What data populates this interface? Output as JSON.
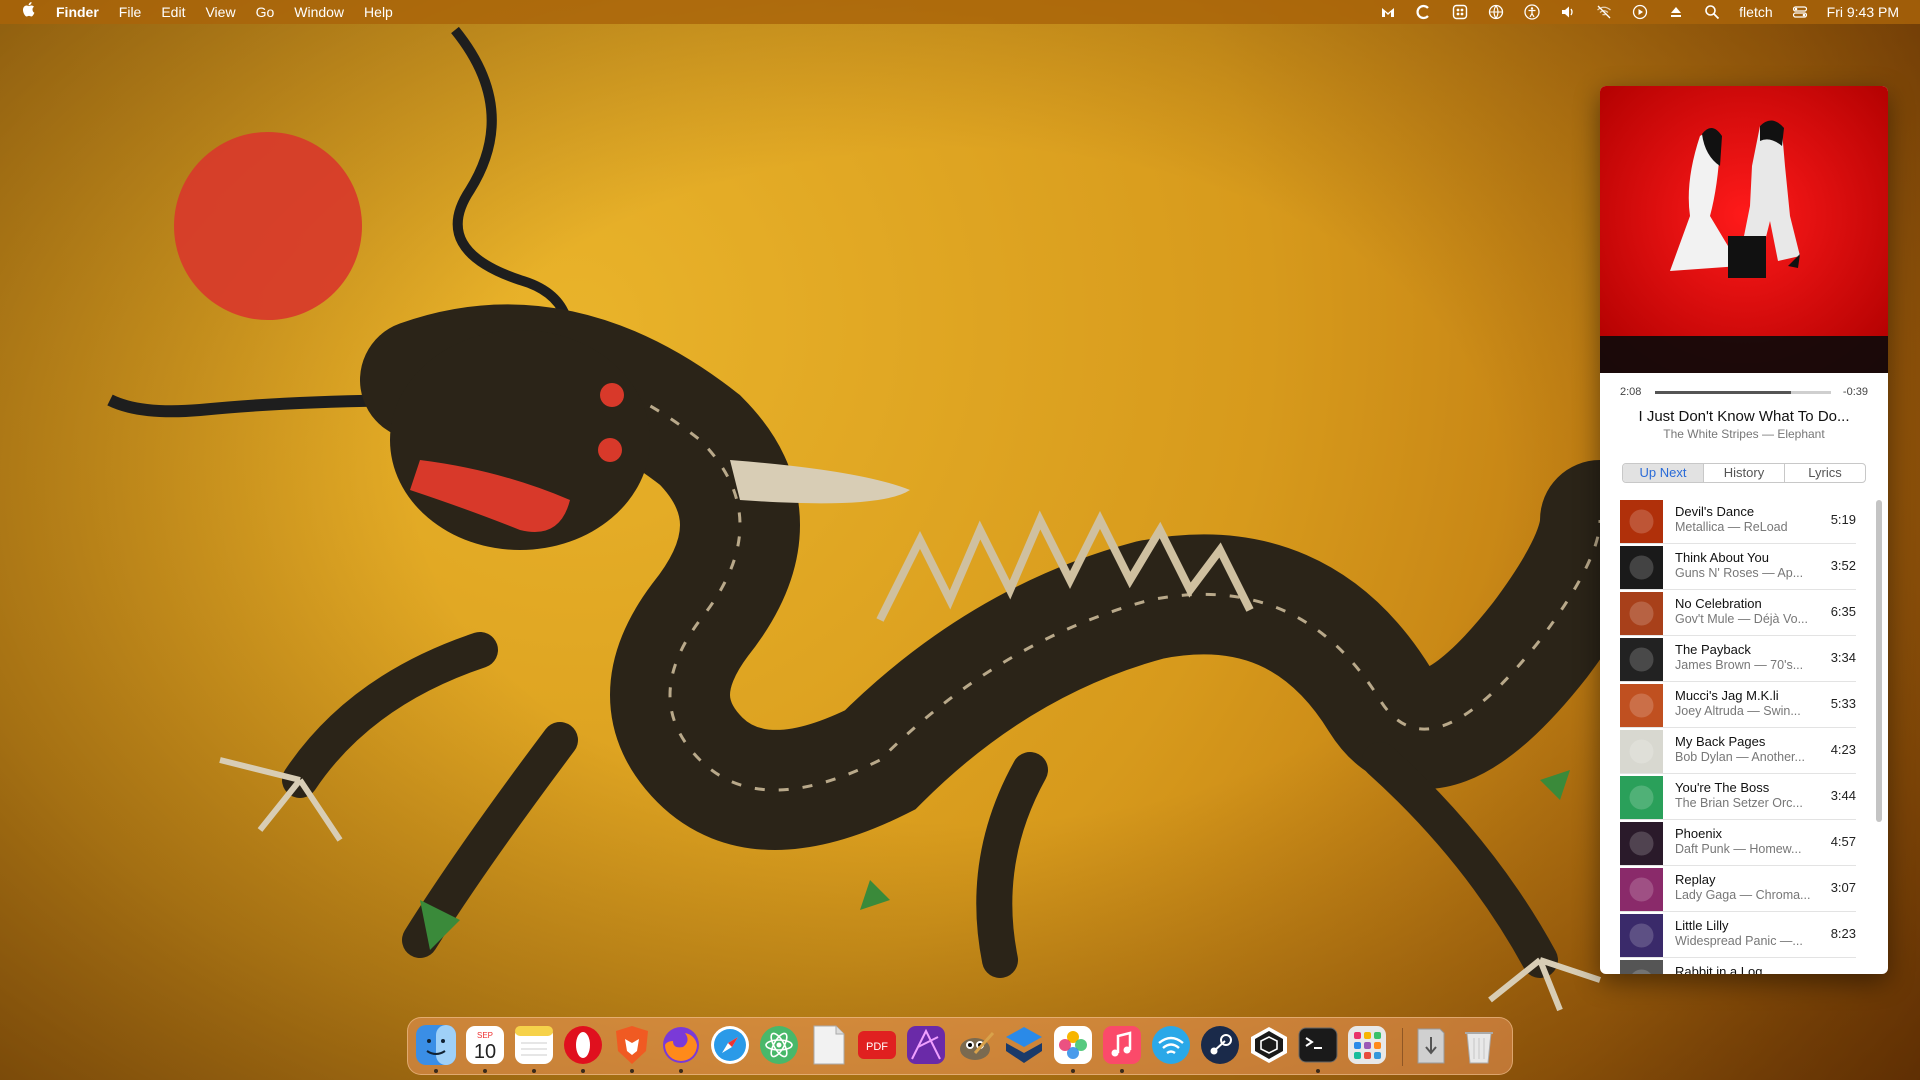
{
  "menubar": {
    "apple_icon": "apple-icon",
    "app_name": "Finder",
    "menus": [
      "File",
      "Edit",
      "View",
      "Go",
      "Window",
      "Help"
    ],
    "status_icons": [
      "malwarebytes-icon",
      "cleanmymac-icon",
      "control-grid-icon",
      "vpn-globe-icon",
      "accessibility-icon",
      "volume-icon",
      "wifi-off-icon",
      "play-icon",
      "eject-icon",
      "search-icon"
    ],
    "user": "fletch",
    "control_center_icon": "control-center-icon",
    "clock": "Fri 9:43 PM"
  },
  "player": {
    "elapsed": "2:08",
    "remaining": "-0:39",
    "progress": 0.77,
    "title": "I Just Don't Know What To Do...",
    "subtitle": "The White Stripes — Elephant",
    "tabs": [
      "Up Next",
      "History",
      "Lyrics"
    ],
    "active_tab": "Up Next",
    "queue": [
      {
        "title": "Devil's Dance",
        "sub": "Metallica — ReLoad",
        "dur": "5:19",
        "art": "#b0300a"
      },
      {
        "title": "Think About You",
        "sub": "Guns N' Roses — Ap...",
        "dur": "3:52",
        "art": "#1a1a1a"
      },
      {
        "title": "No Celebration",
        "sub": "Gov't Mule — Déjà Vo...",
        "dur": "6:35",
        "art": "#a8401a"
      },
      {
        "title": "The Payback",
        "sub": "James Brown — 70's...",
        "dur": "3:34",
        "art": "#222222"
      },
      {
        "title": "Mucci's Jag M.K.li",
        "sub": "Joey Altruda — Swin...",
        "dur": "5:33",
        "art": "#c05020"
      },
      {
        "title": "My Back Pages",
        "sub": "Bob Dylan — Another...",
        "dur": "4:23",
        "art": "#d8d8d0"
      },
      {
        "title": "You're The Boss",
        "sub": "The Brian Setzer Orc...",
        "dur": "3:44",
        "art": "#2aa05a"
      },
      {
        "title": "Phoenix",
        "sub": "Daft Punk — Homew...",
        "dur": "4:57",
        "art": "#2a1a2a"
      },
      {
        "title": "Replay",
        "sub": "Lady Gaga — Chroma...",
        "dur": "3:07",
        "art": "#8a2a6a"
      },
      {
        "title": "Little Lilly",
        "sub": "Widespread Panic —...",
        "dur": "8:23",
        "art": "#3a2a6a"
      },
      {
        "title": "Rabbit in a Log",
        "sub": "",
        "dur": "",
        "art": "#555555"
      }
    ]
  },
  "dock": {
    "calendar_month": "SEP",
    "calendar_day": "10",
    "pdf_label": "PDF",
    "apps": [
      {
        "name": "finder-icon",
        "color": "#3a8ee6",
        "running": true
      },
      {
        "name": "calendar-icon",
        "color": "#ffffff",
        "running": true
      },
      {
        "name": "notes-icon",
        "color": "#f6d24a",
        "running": true
      },
      {
        "name": "opera-icon",
        "color": "#e0101e",
        "running": true
      },
      {
        "name": "brave-icon",
        "color": "#f05a22",
        "running": true
      },
      {
        "name": "firefox-icon",
        "color": "#ff8a1a",
        "running": true
      },
      {
        "name": "safari-icon",
        "color": "#2a9ae8",
        "running": false
      },
      {
        "name": "atom-icon",
        "color": "#48b86a",
        "running": false
      },
      {
        "name": "textedit-icon",
        "color": "#f2f2f2",
        "running": false
      },
      {
        "name": "pdf-expert-icon",
        "color": "#e02020",
        "running": false
      },
      {
        "name": "affinity-photo-icon",
        "color": "#6a2aa8",
        "running": false
      },
      {
        "name": "gimp-icon",
        "color": "#7a6a50",
        "running": false
      },
      {
        "name": "layers-app-icon",
        "color": "#1a3a6a",
        "running": false
      },
      {
        "name": "photos-icon",
        "color": "#ffffff",
        "running": true
      },
      {
        "name": "music-icon",
        "color": "#fb4a6a",
        "running": true
      },
      {
        "name": "wifi-explorer-icon",
        "color": "#2aa8e8",
        "running": false
      },
      {
        "name": "steam-icon",
        "color": "#1a2a4a",
        "running": false
      },
      {
        "name": "sketchup-icon",
        "color": "#1a1a1a",
        "running": false
      },
      {
        "name": "terminal-icon",
        "color": "#1a1a1a",
        "running": true
      },
      {
        "name": "launchpad-icon",
        "color": "#e8e8e8",
        "running": false
      },
      {
        "name": "downloads-stack-icon",
        "color": "#d0d0d0",
        "running": false
      },
      {
        "name": "trash-icon",
        "color": "#e8e8e8",
        "running": false
      }
    ]
  }
}
